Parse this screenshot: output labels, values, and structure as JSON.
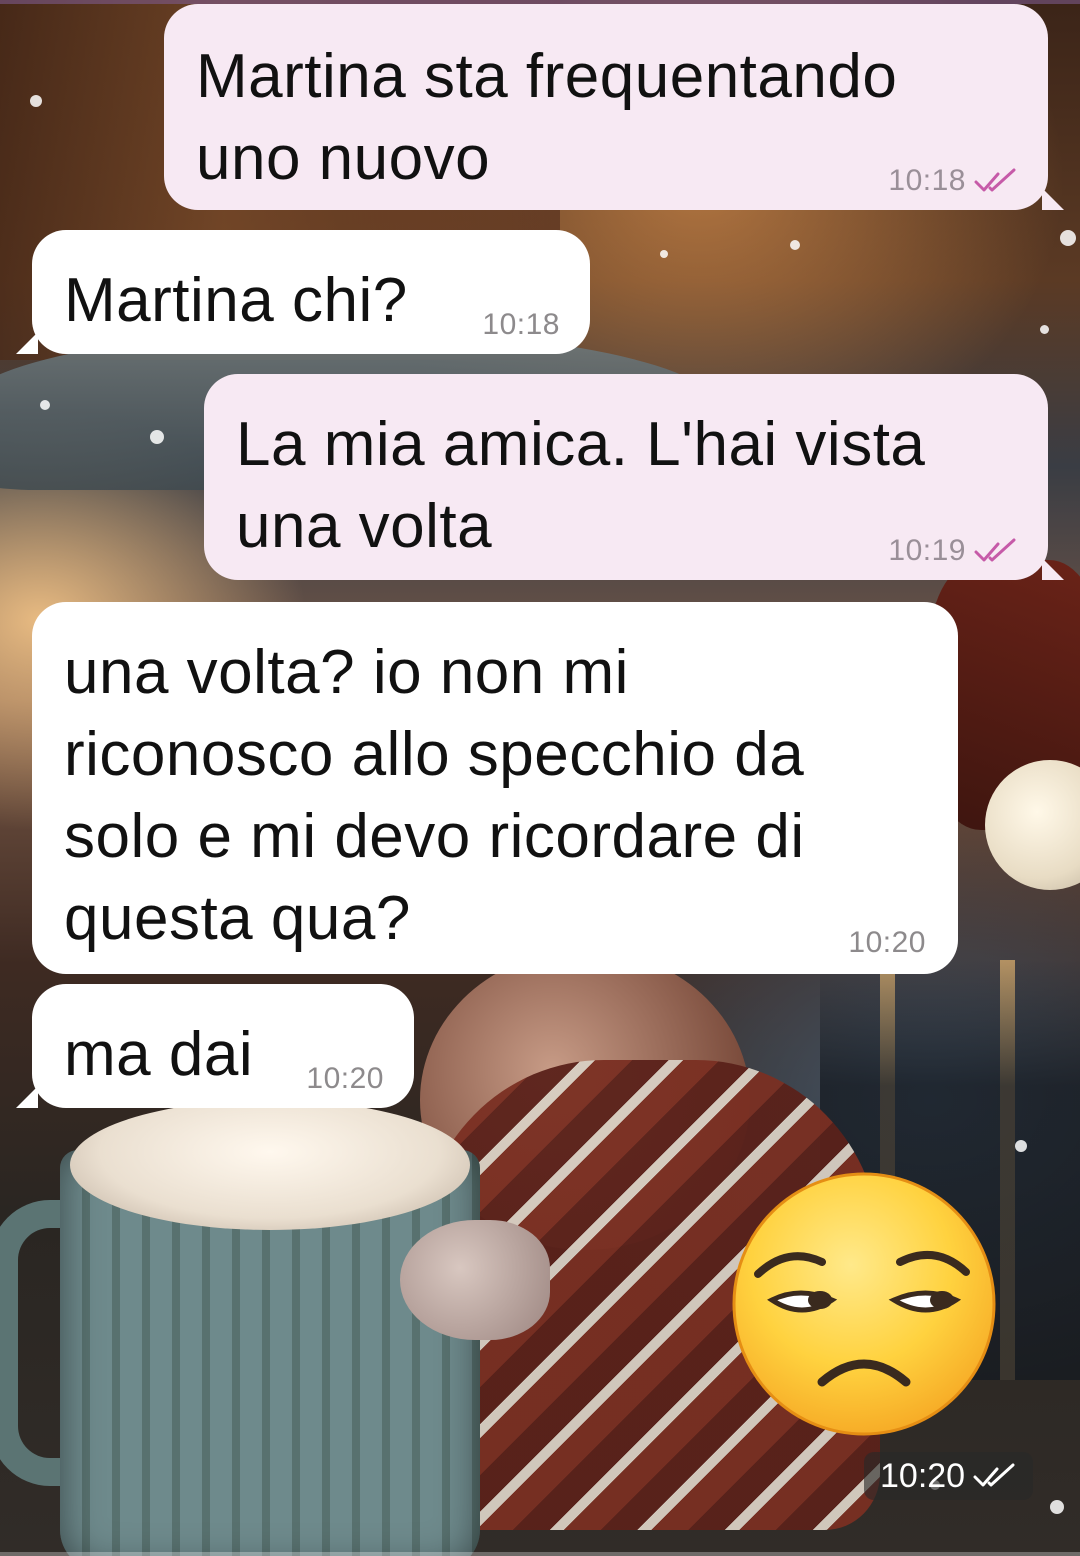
{
  "colors": {
    "outgoing_bubble": "#f7e9f3",
    "incoming_bubble": "#ffffff",
    "read_ticks_outgoing": "#c65aa8",
    "read_ticks_chip": "#ffffff"
  },
  "wallpaper": {
    "icon": "painted-winter-scene-with-hot-cocoa"
  },
  "messages": [
    {
      "direction": "outgoing",
      "text": "Martina sta frequentando\nuno nuovo",
      "time": "10:18",
      "status": "read"
    },
    {
      "direction": "incoming",
      "text": "Martina chi?",
      "time": "10:18"
    },
    {
      "direction": "outgoing",
      "text": "La mia amica. L'hai vista\nuna volta",
      "time": "10:19",
      "status": "read"
    },
    {
      "direction": "incoming",
      "text": "una volta? io non mi\nriconosco allo specchio da\nsolo e mi devo ricordare di\nquesta qua?",
      "time": "10:20"
    },
    {
      "direction": "incoming",
      "text": "ma dai",
      "time": "10:20"
    },
    {
      "direction": "outgoing",
      "type": "emoji",
      "emoji": "unamused-face-emoji",
      "time": "10:20",
      "status": "read"
    }
  ]
}
